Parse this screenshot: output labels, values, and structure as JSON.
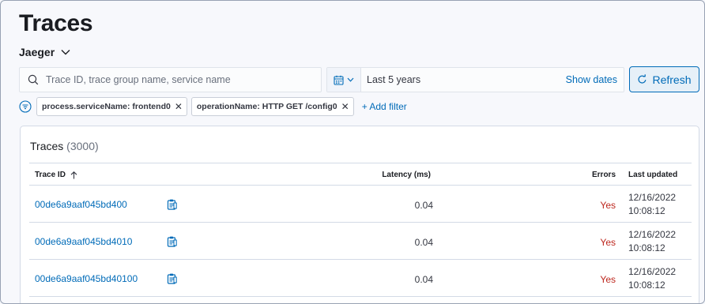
{
  "page": {
    "title": "Traces"
  },
  "datasource": {
    "label": "Jaeger"
  },
  "search": {
    "placeholder": "Trace ID, trace group name, service name",
    "value": ""
  },
  "date_picker": {
    "range_label": "Last 5 years",
    "show_dates_label": "Show dates"
  },
  "refresh": {
    "label": "Refresh"
  },
  "filters": {
    "pills": [
      {
        "label": "process.serviceName: frontend0"
      },
      {
        "label": "operationName: HTTP GET /config0"
      }
    ],
    "add_label": "+ Add filter"
  },
  "panel": {
    "title": "Traces",
    "count": "(3000)",
    "columns": {
      "trace_id": "Trace ID",
      "latency": "Latency (ms)",
      "errors": "Errors",
      "last_updated": "Last updated"
    },
    "rows": [
      {
        "trace_id": "00de6a9aaf045bd400",
        "latency": "0.04",
        "errors": "Yes",
        "date": "12/16/2022",
        "time": "10:08:12"
      },
      {
        "trace_id": "00de6a9aaf045bd4010",
        "latency": "0.04",
        "errors": "Yes",
        "date": "12/16/2022",
        "time": "10:08:12"
      },
      {
        "trace_id": "00de6a9aaf045bd40100",
        "latency": "0.04",
        "errors": "Yes",
        "date": "12/16/2022",
        "time": "10:08:12"
      }
    ]
  },
  "colors": {
    "link": "#006bb8",
    "error": "#bd271e",
    "text": "#343741"
  },
  "icons": {
    "search": "search-icon",
    "calendar": "calendar-icon",
    "refresh": "refresh-icon",
    "filter": "filter-icon",
    "sort": "sort-up-icon",
    "copy": "copy-clipboard-icon"
  }
}
